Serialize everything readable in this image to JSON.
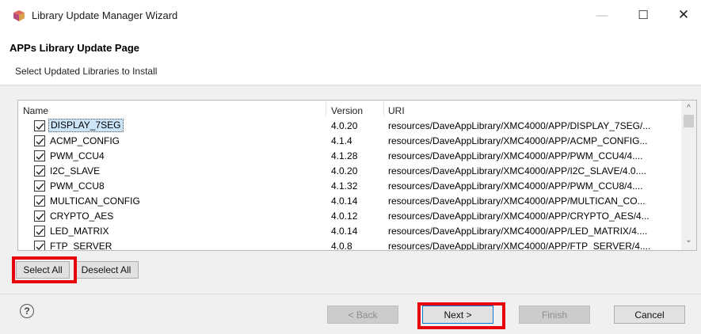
{
  "window": {
    "title": "Library Update Manager Wizard",
    "minimize_glyph": "—",
    "maximize_glyph": "☐",
    "close_glyph": "✕"
  },
  "page": {
    "title": "APPs Library Update Page",
    "description": "Select Updated Libraries to Install"
  },
  "table": {
    "columns": [
      "Name",
      "Version",
      "URI"
    ],
    "rows": [
      {
        "name": "DISPLAY_7SEG",
        "version": "4.0.20",
        "uri": "resources/DaveAppLibrary/XMC4000/APP/DISPLAY_7SEG/...",
        "checked": true,
        "selected": true
      },
      {
        "name": "ACMP_CONFIG",
        "version": "4.1.4",
        "uri": "resources/DaveAppLibrary/XMC4000/APP/ACMP_CONFIG...",
        "checked": true,
        "selected": false
      },
      {
        "name": "PWM_CCU4",
        "version": "4.1.28",
        "uri": "resources/DaveAppLibrary/XMC4000/APP/PWM_CCU4/4....",
        "checked": true,
        "selected": false
      },
      {
        "name": "I2C_SLAVE",
        "version": "4.0.20",
        "uri": "resources/DaveAppLibrary/XMC4000/APP/I2C_SLAVE/4.0....",
        "checked": true,
        "selected": false
      },
      {
        "name": "PWM_CCU8",
        "version": "4.1.32",
        "uri": "resources/DaveAppLibrary/XMC4000/APP/PWM_CCU8/4....",
        "checked": true,
        "selected": false
      },
      {
        "name": "MULTICAN_CONFIG",
        "version": "4.0.14",
        "uri": "resources/DaveAppLibrary/XMC4000/APP/MULTICAN_CO...",
        "checked": true,
        "selected": false
      },
      {
        "name": "CRYPTO_AES",
        "version": "4.0.12",
        "uri": "resources/DaveAppLibrary/XMC4000/APP/CRYPTO_AES/4...",
        "checked": true,
        "selected": false
      },
      {
        "name": "LED_MATRIX",
        "version": "4.0.14",
        "uri": "resources/DaveAppLibrary/XMC4000/APP/LED_MATRIX/4....",
        "checked": true,
        "selected": false
      },
      {
        "name": "FTP_SERVER",
        "version": "4.0.8",
        "uri": "resources/DaveAppLibrary/XMC4000/APP/FTP_SERVER/4....",
        "checked": true,
        "selected": false
      }
    ],
    "scroll_up_glyph": "^",
    "scroll_down_glyph": "⌄"
  },
  "selection_buttons": {
    "select_all": "Select All",
    "deselect_all": "Deselect All"
  },
  "footer": {
    "help_glyph": "?",
    "back": "< Back",
    "next": "Next >",
    "finish": "Finish",
    "cancel": "Cancel"
  },
  "colors": {
    "highlight": "#e8000b",
    "selection": "#cce4f7",
    "focus_border": "#0078d7"
  }
}
